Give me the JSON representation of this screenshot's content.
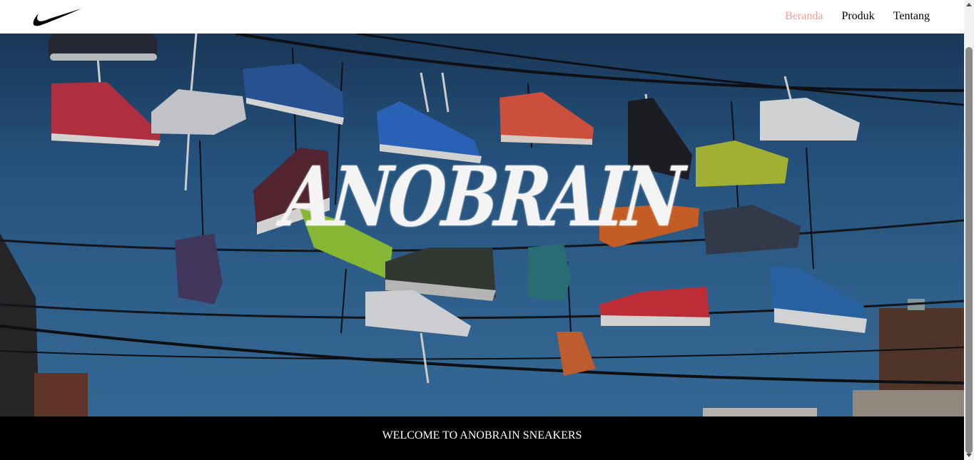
{
  "navbar": {
    "logo_icon": "swoosh-logo-icon",
    "links": [
      {
        "label": "Beranda",
        "active": true
      },
      {
        "label": "Produk",
        "active": false
      },
      {
        "label": "Tentang",
        "active": false
      }
    ]
  },
  "hero": {
    "title": "ANOBRAIN"
  },
  "footer": {
    "text": "WELCOME TO ANOBRAIN SNEAKERS"
  },
  "colors": {
    "active_link": "#f0a0a0",
    "footer_bg": "#000000",
    "sky": "#2b5e8f"
  }
}
